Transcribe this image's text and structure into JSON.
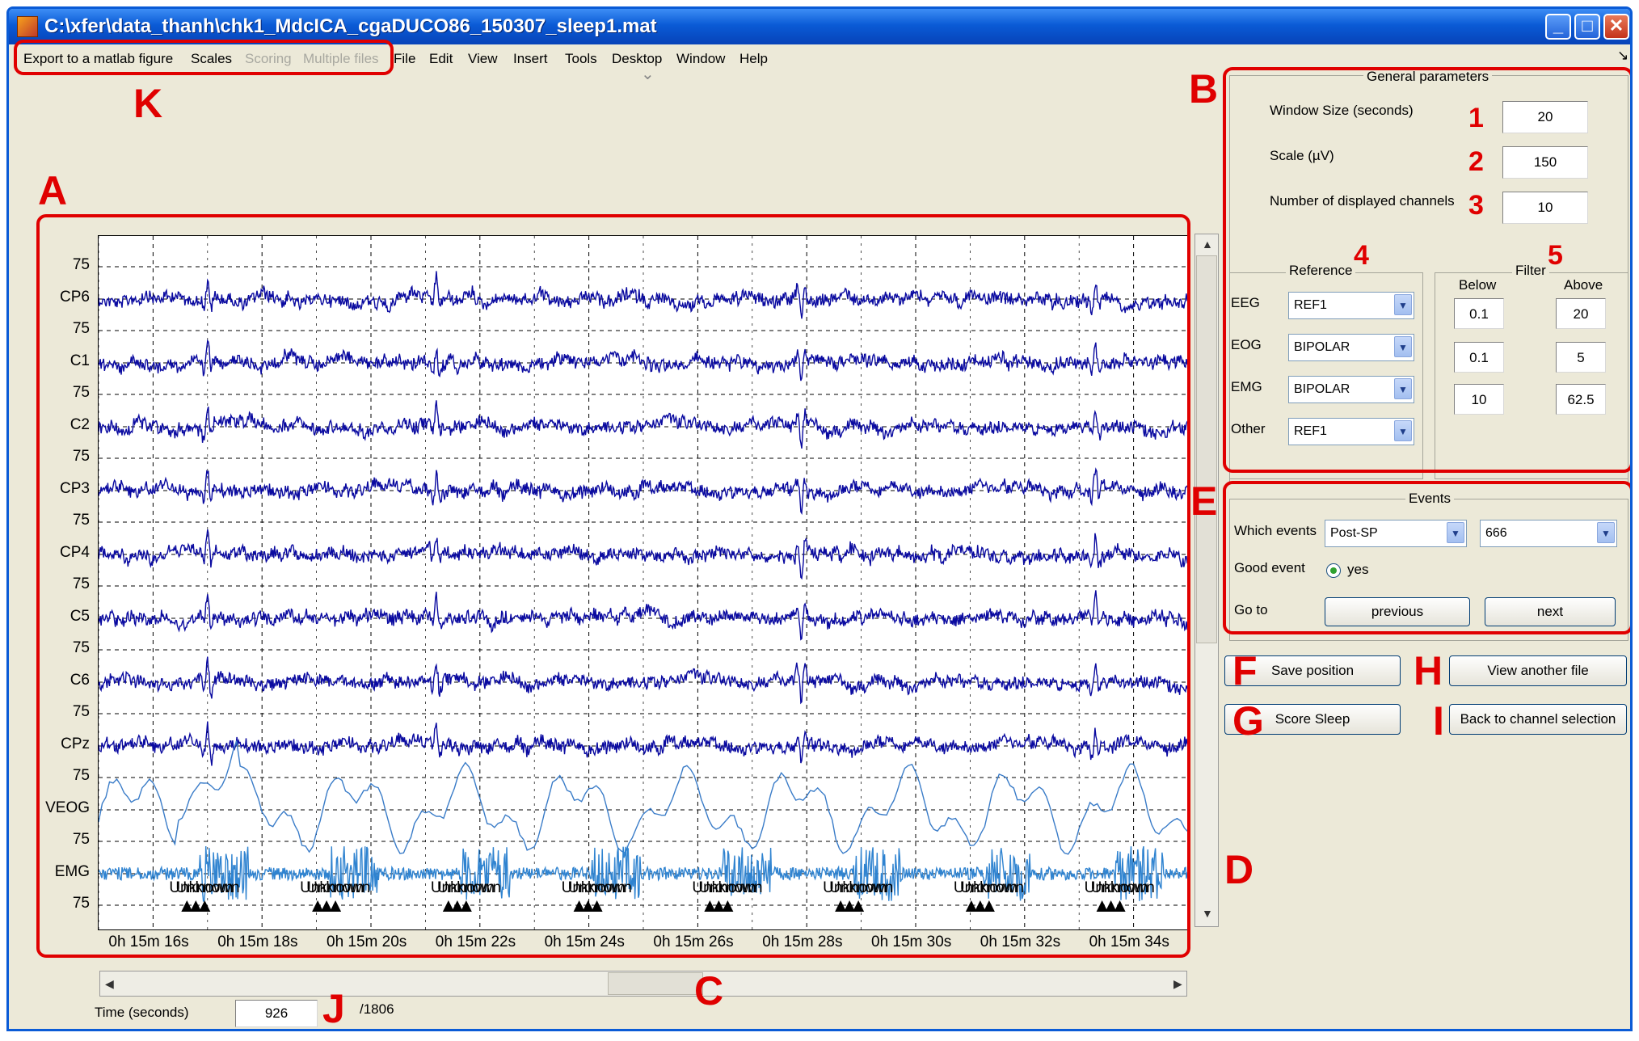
{
  "window": {
    "title": "C:\\xfer\\data_thanh\\chk1_MdcICA_cgaDUCO86_150307_sleep1.mat",
    "controls": {
      "minimize": "_",
      "maximize": "□",
      "close": "✕"
    }
  },
  "menu": {
    "items": [
      {
        "label": "Export to a matlab figure",
        "enabled": true
      },
      {
        "label": "Scales",
        "enabled": true
      },
      {
        "label": "Scoring",
        "enabled": false
      },
      {
        "label": "Multiple files",
        "enabled": false
      },
      {
        "label": "File",
        "enabled": true
      },
      {
        "label": "Edit",
        "enabled": true
      },
      {
        "label": "View",
        "enabled": true
      },
      {
        "label": "Insert",
        "enabled": true
      },
      {
        "label": "Tools",
        "enabled": true
      },
      {
        "label": "Desktop",
        "enabled": true
      },
      {
        "label": "Window",
        "enabled": true
      },
      {
        "label": "Help",
        "enabled": true
      }
    ],
    "toolbar_toggle": "⌄",
    "dock_icon": "↘"
  },
  "annotations": {
    "letters": [
      "A",
      "B",
      "C",
      "D",
      "E",
      "F",
      "G",
      "H",
      "I",
      "J",
      "K"
    ],
    "numbers": [
      "1",
      "2",
      "3",
      "4",
      "5"
    ]
  },
  "chart_data": {
    "type": "line",
    "title": "",
    "xlabel": "",
    "ylabel": "",
    "channels": [
      "CP6",
      "C1",
      "C2",
      "CP3",
      "CP4",
      "C5",
      "C6",
      "CPz",
      "VEOG",
      "EMG"
    ],
    "channel_colors": {
      "eeg": "#0a0aa0",
      "veog": "#3a7cc8",
      "emg": "#2f83d0"
    },
    "scale_tick_label": "75",
    "x_tick_labels": [
      "0h 15m 16s",
      "0h 15m 18s",
      "0h 15m 20s",
      "0h 15m 22s",
      "0h 15m 24s",
      "0h 15m 26s",
      "0h 15m 28s",
      "0h 15m 30s",
      "0h 15m 32s",
      "0h 15m 34s"
    ],
    "xlim_seconds": [
      915,
      935
    ],
    "grid": "dashed",
    "event_label": "Unknown",
    "event_times_seconds": [
      916.8,
      919.2,
      921.6,
      924.0,
      926.4,
      928.8,
      931.2,
      933.6
    ]
  },
  "time_control": {
    "label": "Time (seconds)",
    "value": "926",
    "total": "/1806"
  },
  "general_parameters": {
    "title": "General parameters",
    "window_size_label": "Window Size (seconds)",
    "window_size": "20",
    "scale_label": "Scale (µV)",
    "scale": "150",
    "channels_label": "Number of displayed channels",
    "channels": "10"
  },
  "reference": {
    "title": "Reference",
    "rows": [
      {
        "label": "EEG",
        "value": "REF1"
      },
      {
        "label": "EOG",
        "value": "BIPOLAR"
      },
      {
        "label": "EMG",
        "value": "BIPOLAR"
      },
      {
        "label": "Other",
        "value": "REF1"
      }
    ]
  },
  "filter": {
    "title": "Filter",
    "below_label": "Below",
    "above_label": "Above",
    "rows": [
      {
        "below": "0.1",
        "above": "20"
      },
      {
        "below": "0.1",
        "above": "5"
      },
      {
        "below": "10",
        "above": "62.5"
      }
    ]
  },
  "events": {
    "title": "Events",
    "which_label": "Which events",
    "which_value": "Post-SP",
    "code_value": "666",
    "good_label": "Good event",
    "good_option": "yes",
    "goto_label": "Go to",
    "previous": "previous",
    "next": "next"
  },
  "buttons": {
    "save_position": "Save position",
    "view_another": "View another file",
    "score_sleep": "Score Sleep",
    "back_channels": "Back to channel selection"
  }
}
